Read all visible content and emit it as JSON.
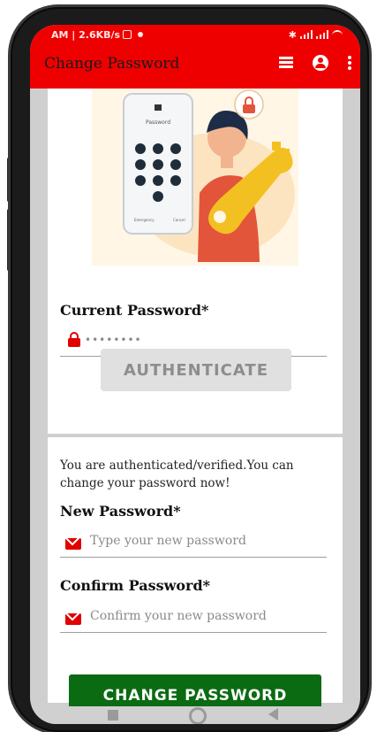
{
  "status_bar": {
    "left_text": "AM | 2.6KB/s",
    "right_text": "✱"
  },
  "app_bar": {
    "title": "Change Password",
    "icons": [
      "list-icon",
      "account-icon",
      "more-vert-icon"
    ]
  },
  "illustration": {
    "pin_screen_label": "Password",
    "pin_bottom_left": "Emergency",
    "pin_bottom_right": "Cancel"
  },
  "current_password": {
    "label": "Current Password*",
    "value": "••••••••",
    "icon": "lock-icon"
  },
  "authenticate_button": {
    "label": "AUTHENTICATE"
  },
  "auth_message": "You are authenticated/verified.You can change your password now!",
  "new_password": {
    "label": "New Password*",
    "placeholder": "Type your new password",
    "icon": "mail-icon"
  },
  "confirm_password": {
    "label": "Confirm Password*",
    "placeholder": "Confirm your new password",
    "icon": "mail-icon"
  },
  "change_button": {
    "label": "CHANGE PASSWORD"
  },
  "colors": {
    "app_bar": "#ee0000",
    "accent_icon": "#e00000",
    "primary_button": "#0b6b13",
    "disabled_button": "#e0e0e0"
  }
}
